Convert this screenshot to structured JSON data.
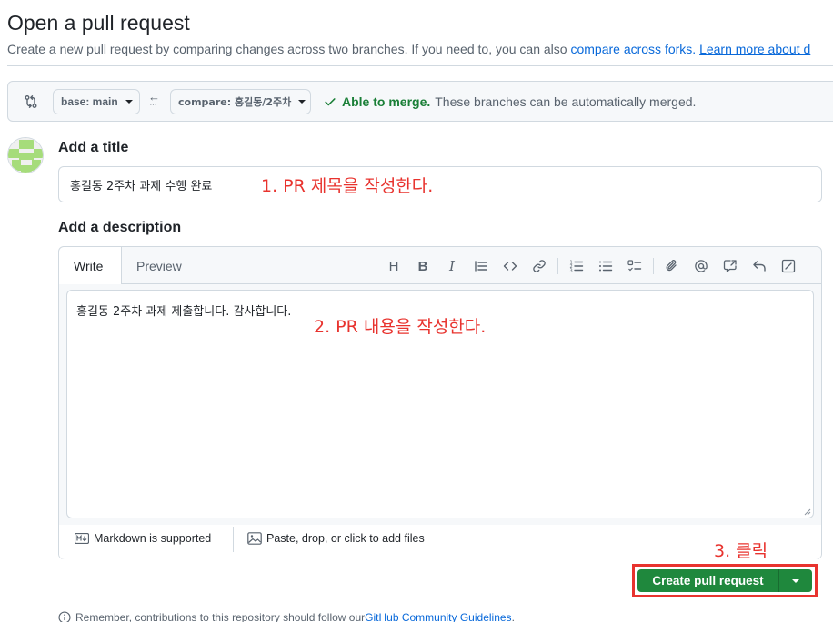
{
  "header": {
    "title": "Open a pull request",
    "subtitle_text": "Create a new pull request by comparing changes across two branches. If you need to, you can also ",
    "compare_forks_link": "compare across forks.",
    "learn_more_link": "Learn more about d"
  },
  "range": {
    "base_label": "base: main",
    "compare_label": "compare: 홍길동/2주차",
    "status_ok": "Able to merge.",
    "status_msg": "These branches can be automatically merged."
  },
  "form": {
    "title_label": "Add a title",
    "title_value": "홍길동 2주차 과제 수행 완료",
    "desc_label": "Add a description",
    "desc_value": "홍길동 2주차 과제 제출합니다. 감사합니다."
  },
  "editor": {
    "tabs": [
      "Write",
      "Preview"
    ],
    "toolbar_icons": [
      "heading-icon",
      "bold-icon",
      "italic-icon",
      "quote-icon",
      "code-icon",
      "link-icon",
      "numbered-list-icon",
      "bullet-list-icon",
      "task-list-icon",
      "attach-icon",
      "mention-icon",
      "reference-icon",
      "undo-icon",
      "fullscreen-icon"
    ],
    "markdown_note": "Markdown is supported",
    "attach_note": "Paste, drop, or click to add files"
  },
  "annotations": {
    "step1": "1. PR 제목을 작성한다.",
    "step2": "2. PR 내용을 작성한다.",
    "step3": "3. 클릭",
    "highlight_color": "#e8332e"
  },
  "actions": {
    "create_label": "Create pull request"
  },
  "footer": {
    "remember_text": "Remember, contributions to this repository should follow our",
    "guidelines_link": "GitHub Community Guidelines",
    "period": "."
  },
  "colors": {
    "accent": "#0969da",
    "success": "#1a7f37",
    "primary_button": "#1f883d"
  }
}
